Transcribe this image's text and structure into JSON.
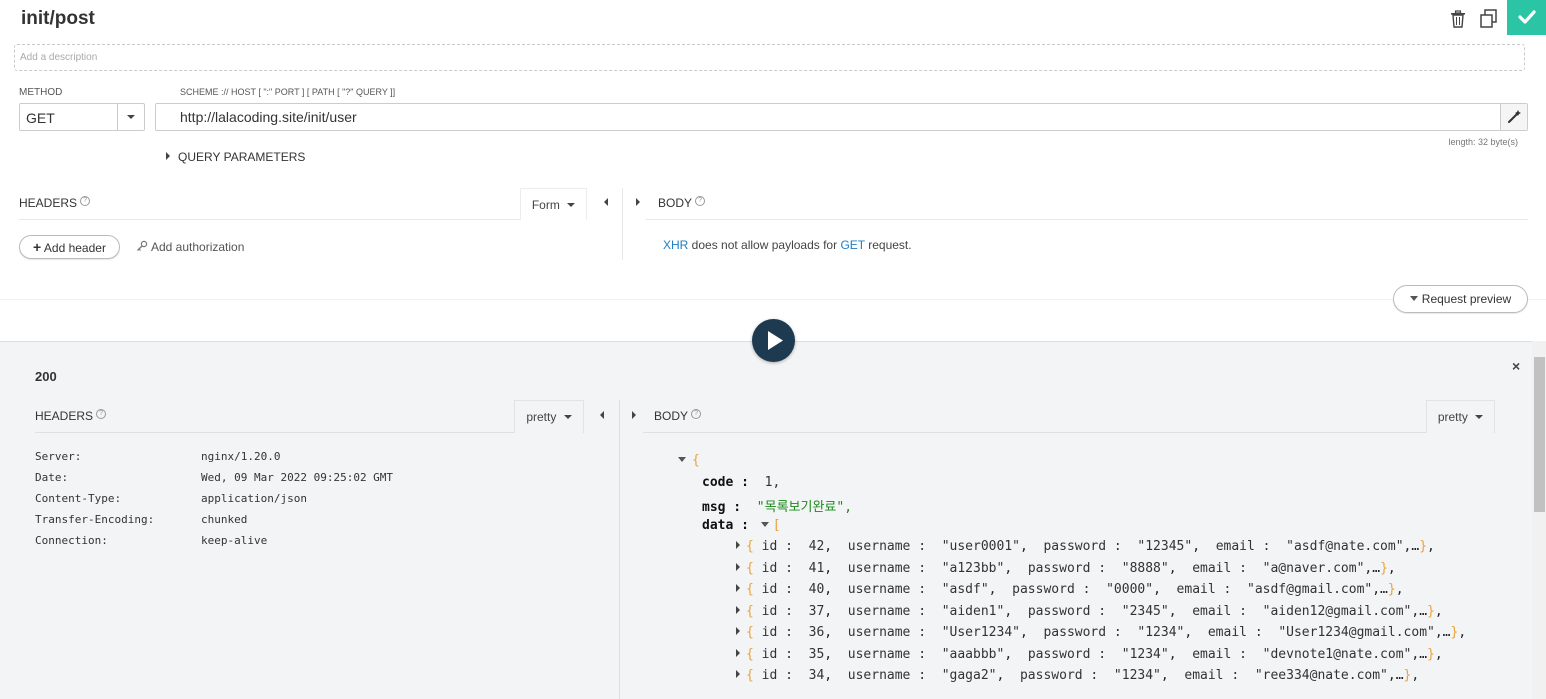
{
  "request": {
    "title": "init/post",
    "description_placeholder": "Add a description",
    "method_label": "METHOD",
    "scheme_label": "SCHEME :// HOST [ \":\" PORT ] [ PATH [ \"?\" QUERY ]]",
    "method": "GET",
    "url": "http://lalacoding.site/init/user",
    "length": "length: 32 byte(s)",
    "query_parameters": "QUERY PARAMETERS",
    "headers_title": "HEADERS",
    "body_title": "BODY",
    "form_label": "Form",
    "add_header": "Add header",
    "add_authorization": "Add authorization",
    "xhr_note": {
      "xhr": "XHR",
      "mid": " does not allow payloads for ",
      "method": "GET",
      "end": " request."
    },
    "request_preview": "Request preview"
  },
  "response": {
    "status": "200",
    "headers_title": "HEADERS",
    "body_title": "BODY",
    "pretty_label": "pretty",
    "headers": [
      {
        "name": "Server:",
        "value": "nginx/1.20.0"
      },
      {
        "name": "Date:",
        "value": "Wed, 09 Mar 2022 09:25:02 GMT"
      },
      {
        "name": "Content-Type:",
        "value": "application/json"
      },
      {
        "name": "Transfer-Encoding:",
        "value": "chunked"
      },
      {
        "name": "Connection:",
        "value": "keep-alive"
      }
    ],
    "body": {
      "code_key": "code :",
      "code_value": "1,",
      "msg_key": "msg :",
      "msg_value": "\"목록보기완료\",",
      "data_key": "data :",
      "items": [
        {
          "id": "42",
          "username": "\"user0001\"",
          "password": "\"12345\"",
          "email": "\"asdf@nate.com\""
        },
        {
          "id": "41",
          "username": "\"a123bb\"",
          "password": "\"8888\"",
          "email": "\"a@naver.com\""
        },
        {
          "id": "40",
          "username": "\"asdf\"",
          "password": "\"0000\"",
          "email": "\"asdf@gmail.com\""
        },
        {
          "id": "37",
          "username": "\"aiden1\"",
          "password": "\"2345\"",
          "email": "\"aiden12@gmail.com\""
        },
        {
          "id": "36",
          "username": "\"User1234\"",
          "password": "\"1234\"",
          "email": "\"User1234@gmail.com\""
        },
        {
          "id": "35",
          "username": "\"aaabbb\"",
          "password": "\"1234\"",
          "email": "\"devnote1@nate.com\""
        },
        {
          "id": "34",
          "username": "\"gaga2\"",
          "password": "\"1234\"",
          "email": "\"ree334@nate.com\""
        }
      ]
    }
  },
  "colors": {
    "accent": "#2bc5a6",
    "send_button": "#1d3a50",
    "link_blue": "#1e7fc2",
    "json_brace": "#e8a33d",
    "json_string": "#1a8a1a"
  },
  "icons": [
    "trash-icon",
    "copy-icon",
    "check-icon",
    "magic-wand-icon",
    "play-icon",
    "plus-icon",
    "key-icon",
    "help-icon",
    "close-icon"
  ]
}
